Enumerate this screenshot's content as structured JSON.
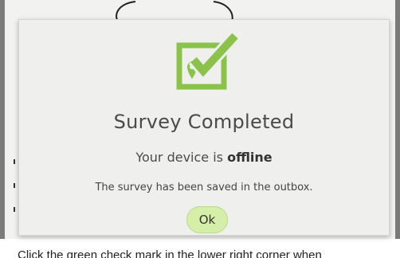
{
  "background": {
    "footer_text": "Click the green check mark in the lower right corner when"
  },
  "dialog": {
    "icon": "survey-checked-location-icon",
    "title": "Survey Completed",
    "status_prefix": "Your device is ",
    "status_value": "offline",
    "message": "The survey has been saved in the outbox.",
    "ok_label": "Ok"
  },
  "colors": {
    "accent_green": "#8bc34a",
    "button_fill": "#d6efa8"
  }
}
